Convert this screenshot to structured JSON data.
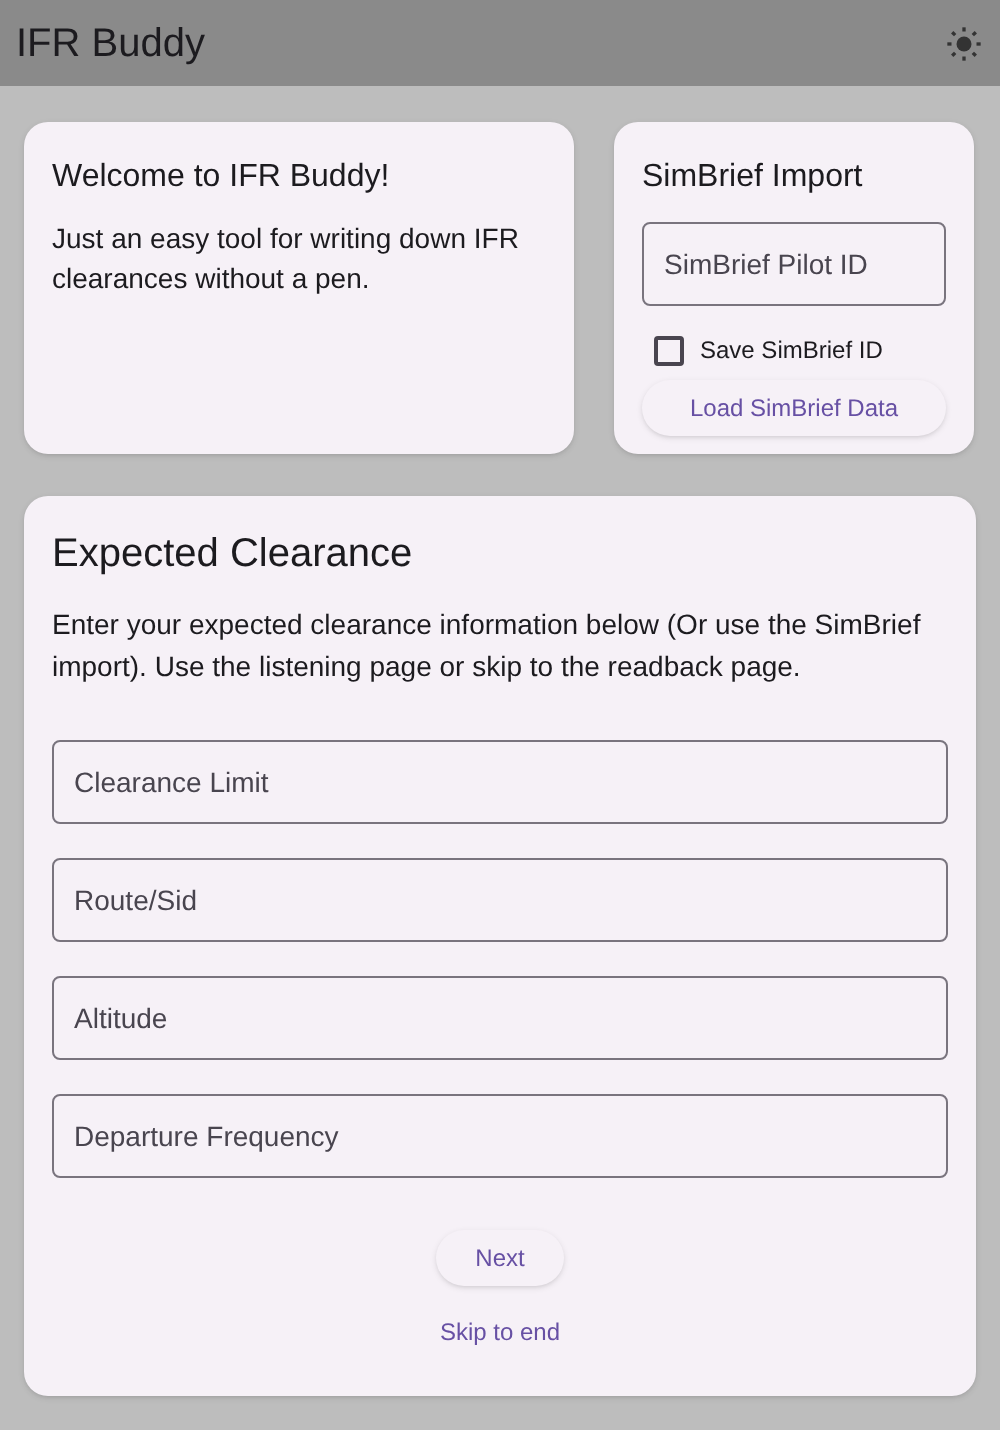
{
  "app_bar": {
    "title": "IFR Buddy"
  },
  "welcome": {
    "title": "Welcome to IFR Buddy!",
    "text": "Just an easy tool for writing down IFR clearances without a pen."
  },
  "simbrief": {
    "title": "SimBrief Import",
    "pilot_id": {
      "placeholder": "SimBrief Pilot ID"
    },
    "save_id": {
      "label": "Save SimBrief ID",
      "checked": false
    },
    "load_button": "Load SimBrief Data"
  },
  "clearance": {
    "title": "Expected Clearance",
    "text": "Enter your expected clearance information below (Or use the SimBrief import). Use the listening page or skip to the readback page.",
    "fields": [
      {
        "placeholder": "Clearance Limit"
      },
      {
        "placeholder": "Route/Sid"
      },
      {
        "placeholder": "Altitude"
      },
      {
        "placeholder": "Departure Frequency"
      }
    ],
    "next_button": "Next",
    "skip_link": "Skip to end"
  }
}
